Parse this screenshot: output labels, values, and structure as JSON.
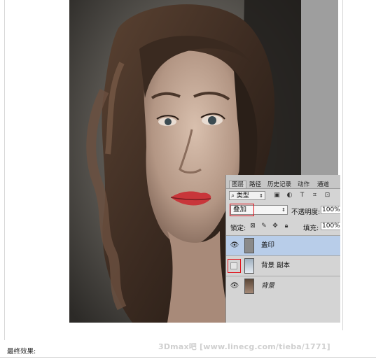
{
  "panel": {
    "tabs": [
      "图层",
      "路径",
      "历史记录",
      "动作",
      "通道"
    ],
    "kind_filter": "类型",
    "filter_icons": [
      "image-filter-icon",
      "adjustment-filter-icon",
      "type-filter-icon",
      "shape-filter-icon",
      "smart-object-filter-icon"
    ],
    "blend_mode": "叠加",
    "opacity_label": "不透明度:",
    "opacity_value": "100%",
    "lock_label": "锁定:",
    "lock_icons": [
      "lock-transparent-pixels-icon",
      "lock-image-pixels-icon",
      "lock-position-icon",
      "lock-all-icon"
    ],
    "fill_label": "填充:",
    "fill_value": "100%",
    "layers": [
      {
        "name": "盖印",
        "visible": true,
        "selected": true
      },
      {
        "name": "背景 副本",
        "visible": false,
        "selected": false
      },
      {
        "name": "背景",
        "visible": true,
        "selected": false,
        "italic": true
      }
    ]
  },
  "caption": "最终效果:",
  "watermark": "3Dmax吧 [www.linecg.com/tieba/1771]",
  "colors": {
    "highlight_box": "#e0121b",
    "selected_layer": "#b8cde9",
    "panel_bg": "#d4d4d4"
  }
}
